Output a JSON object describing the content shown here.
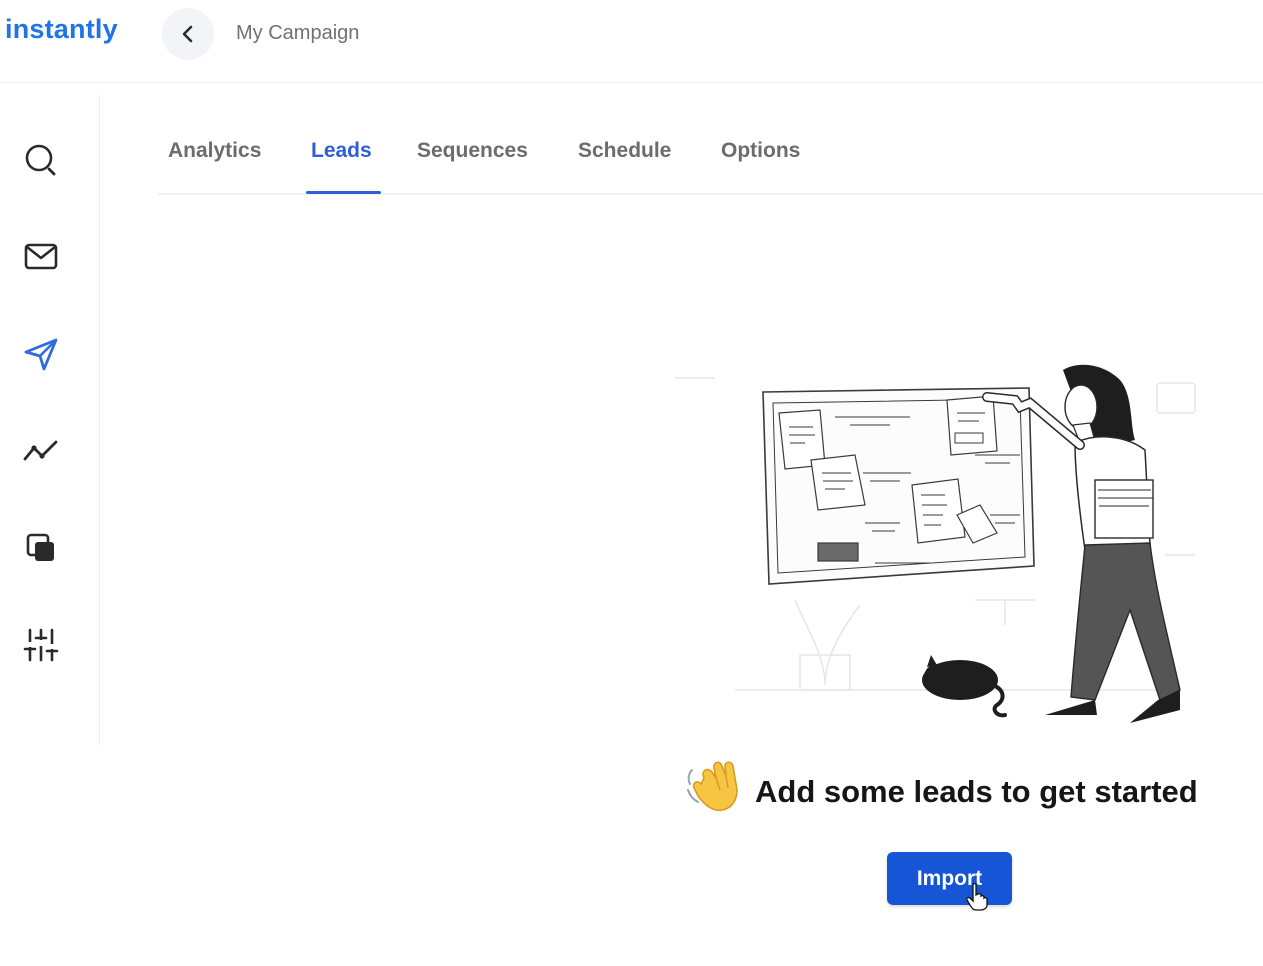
{
  "app": {
    "logo": "instantly",
    "accent": "#2f5fd8",
    "button_color": "#1555d6"
  },
  "header": {
    "back_icon": "chevron-left-icon",
    "title": "My Campaign"
  },
  "sidebar": {
    "items": [
      {
        "icon": "search-icon"
      },
      {
        "icon": "mail-icon"
      },
      {
        "icon": "send-icon",
        "active": true
      },
      {
        "icon": "analytics-icon"
      },
      {
        "icon": "copy-icon"
      },
      {
        "icon": "settings-sliders-icon"
      }
    ]
  },
  "tabs": [
    {
      "label": "Analytics"
    },
    {
      "label": "Leads",
      "active": true
    },
    {
      "label": "Sequences"
    },
    {
      "label": "Schedule"
    },
    {
      "label": "Options"
    }
  ],
  "empty_state": {
    "emoji": "waving-hand-icon",
    "message": "Add some leads to get started",
    "button_label": "Import"
  }
}
